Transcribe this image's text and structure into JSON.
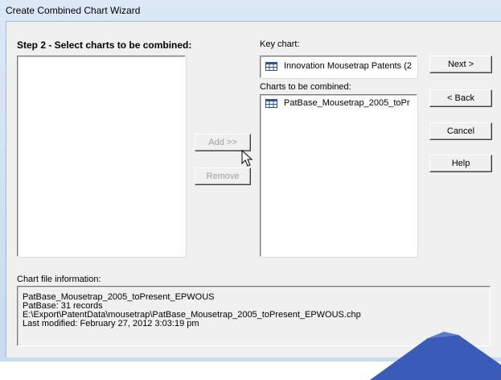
{
  "window": {
    "title": "Create Combined Chart Wizard"
  },
  "step": {
    "title": "Step 2 - Select charts to be combined:"
  },
  "key_chart": {
    "label": "Key chart:",
    "item": "Innovation Mousetrap Patents (2"
  },
  "charts_to_combine": {
    "label": "Charts to be combined:",
    "items": [
      "PatBase_Mousetrap_2005_toPr"
    ]
  },
  "buttons": {
    "add": "Add >>",
    "remove": "Remove",
    "next": "Next >",
    "back": "< Back",
    "cancel": "Cancel",
    "help": "Help"
  },
  "chart_file_info": {
    "label": "Chart file information:",
    "lines": [
      "PatBase_Mousetrap_2005_toPresent_EPWOUS",
      "PatBase: 31 records",
      "E:\\Export\\PatentData\\mousetrap\\PatBase_Mousetrap_2005_toPresent_EPWOUS.chp",
      "Last modified: February 27, 2012 3:03:19 pm"
    ]
  },
  "icons": {
    "chart_item": "table-grid-icon",
    "cursor": "arrow-cursor-icon"
  },
  "colors": {
    "title_gradient_top": "#dbe8f6",
    "title_gradient_bottom": "#c9dbef",
    "dialog_face": "#f0f0f0",
    "grid_icon": "#2f4fa3",
    "watermark": "#3a5bb8"
  }
}
